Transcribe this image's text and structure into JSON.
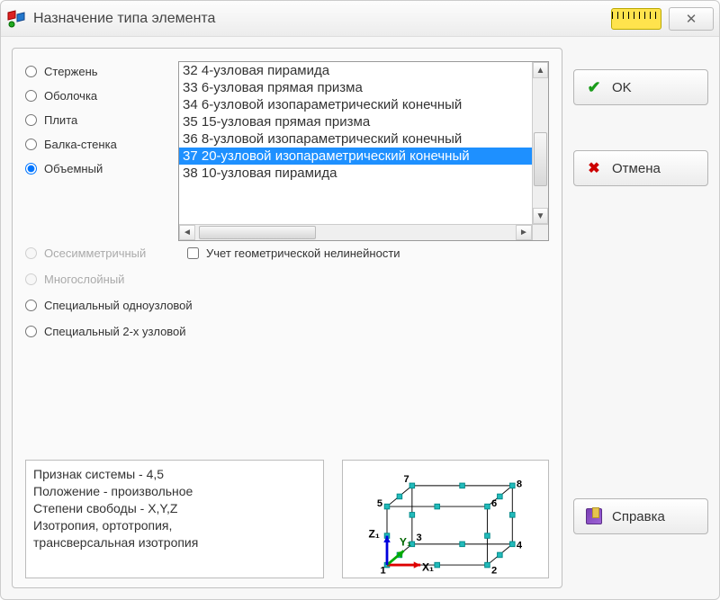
{
  "window": {
    "title": "Назначение типа элемента"
  },
  "radios": {
    "rod": "Стержень",
    "shell": "Оболочка",
    "plate": "Плита",
    "wallbeam": "Балка-стенка",
    "solid": "Объемный",
    "axisym": "Осесимметричный",
    "multilayer": "Многослойный",
    "special1": "Специальный одноузловой",
    "special2": "Специальный 2-х узловой"
  },
  "list": {
    "items": [
      "32 4-узловая пирамида",
      "33 6-узловая прямая призма",
      "34 6-узловой изопараметрический конечный",
      "35 15-узловая прямая призма",
      "36 8-узловой изопараметрический конечный",
      "37 20-узловой изопараметрический конечный",
      "38 10-узловая пирамида"
    ],
    "selected_index": 5
  },
  "checkbox": {
    "geom_nonlin": "Учет геометрической нелинейности"
  },
  "info": {
    "line1": "Признак системы - 4,5",
    "line2": "Положение - произвольное",
    "line3": "Степени свободы - X,Y,Z",
    "line4": "Изотропия, ортотропия,",
    "line5": "трансверсальная изотропия"
  },
  "preview": {
    "nodes": {
      "n1": "1",
      "n2": "2",
      "n3": "3",
      "n4": "4",
      "n5": "5",
      "n6": "6",
      "n7": "7",
      "n8": "8"
    },
    "axes": {
      "x": "X₁",
      "y": "Y₁",
      "z": "Z₁"
    }
  },
  "buttons": {
    "ok": "OK",
    "cancel": "Отмена",
    "help": "Справка"
  }
}
